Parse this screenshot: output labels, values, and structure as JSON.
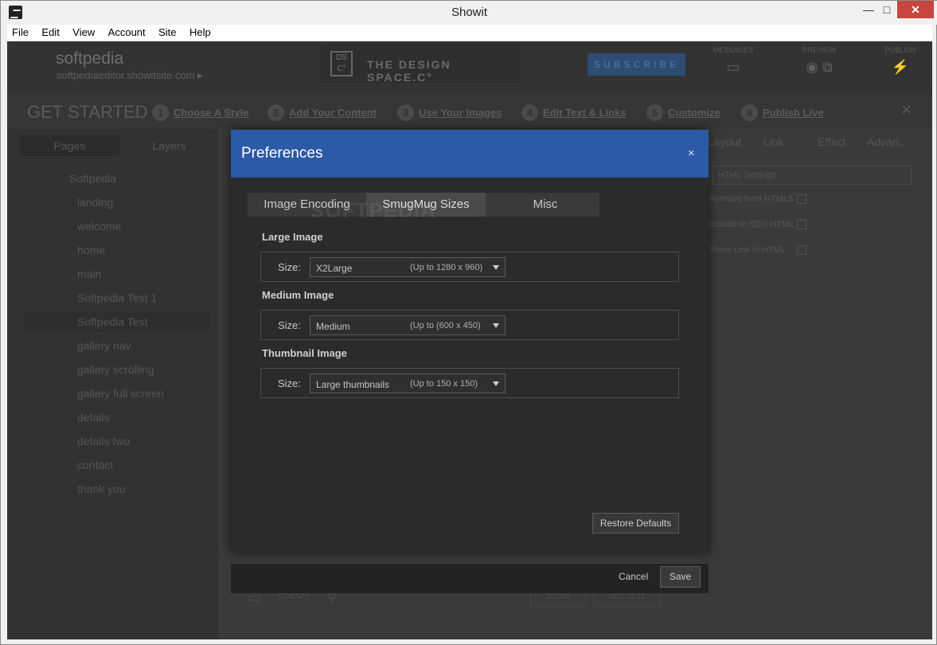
{
  "window": {
    "title": "Showit",
    "minimize": "—",
    "maximize": "□",
    "close": "✕"
  },
  "menu": [
    "File",
    "Edit",
    "View",
    "Account",
    "Site",
    "Help"
  ],
  "header": {
    "site_name": "softpedia",
    "site_url": "softpediaeditor.showitsite.com ▸",
    "promo_logo": "DS C°",
    "promo_text": "THE DESIGN SPACE.C°",
    "subscribe": "SUBSCRIBE",
    "messages": "MESSAGES",
    "preview": "PREVIEW",
    "publish": "PUBLISH"
  },
  "get_started": {
    "title": "GET STARTED",
    "steps": [
      {
        "num": "1",
        "label": "Choose A Style"
      },
      {
        "num": "2",
        "label": "Add Your Content"
      },
      {
        "num": "3",
        "label": "Use Your Images"
      },
      {
        "num": "4",
        "label": "Edit Text & Links"
      },
      {
        "num": "5",
        "label": "Customize"
      },
      {
        "num": "6",
        "label": "Publish Live"
      }
    ],
    "close": "✕"
  },
  "sidebar": {
    "tabs": [
      "Pages",
      "Layers"
    ],
    "tree": [
      "Softpedia",
      "landing",
      "welcome",
      "home",
      "main",
      "Softpedia Test 1",
      "Softpedia Test",
      "gallery nav",
      "gallery scrolling",
      "gallery full screen",
      "details",
      "details two",
      "contact",
      "thank you"
    ]
  },
  "right_panel": {
    "tabs": [
      "Layout",
      "Link",
      "Effect",
      "Advan..."
    ],
    "field": "HTML Settings",
    "rows": [
      "Remove from HTML5",
      "Include in SEO HTML",
      "Show Link In HTML"
    ]
  },
  "bottom_bar": {
    "seo": "<SEO>",
    "media": "MEDIA",
    "add_text": "ADD TEXT"
  },
  "dialog": {
    "title": "Preferences",
    "close": "×",
    "watermark": "SOFTPEDIA",
    "tabs": [
      "Image Encoding",
      "SmugMug Sizes",
      "Misc"
    ],
    "active_tab": "SmugMug Sizes",
    "sections": [
      {
        "title": "Large Image",
        "size_label": "Size:",
        "value": "X2Large",
        "hint": "(Up to 1280 x 960)"
      },
      {
        "title": "Medium Image",
        "size_label": "Size:",
        "value": "Medium",
        "hint": "(Up to (600 x 450)"
      },
      {
        "title": "Thumbnail Image",
        "size_label": "Size:",
        "value": "Large thumbnails",
        "hint": "(Up to 150 x 150)"
      }
    ],
    "restore_defaults": "Restore Defaults",
    "cancel": "Cancel",
    "save": "Save"
  }
}
